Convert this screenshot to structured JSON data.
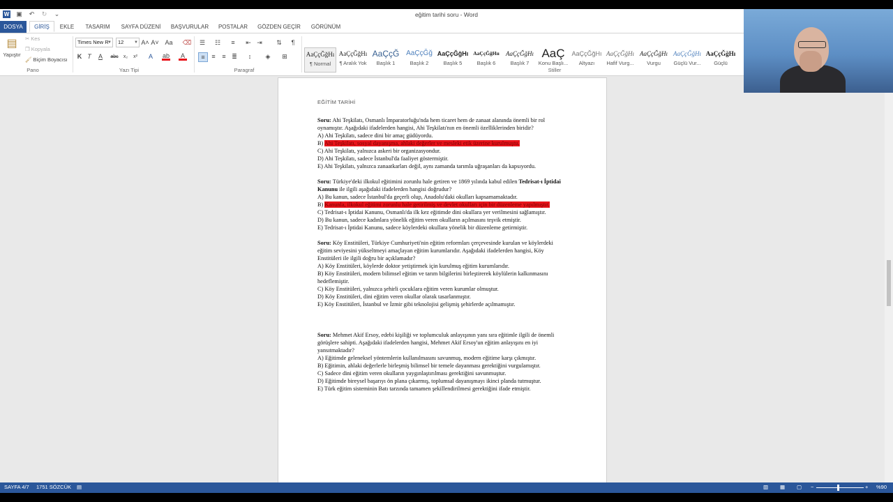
{
  "window": {
    "title": "eğitim tarihi soru - Word"
  },
  "quick_access": {
    "icons": [
      "word-icon",
      "save-icon",
      "undo-icon",
      "redo-icon",
      "customize-icon"
    ]
  },
  "tabs": [
    {
      "label": "DOSYA"
    },
    {
      "label": "GİRİŞ"
    },
    {
      "label": "EKLE"
    },
    {
      "label": "TASARIM"
    },
    {
      "label": "SAYFA DÜZENİ"
    },
    {
      "label": "BAŞVURULAR"
    },
    {
      "label": "POSTALAR"
    },
    {
      "label": "GÖZDEN GEÇİR"
    },
    {
      "label": "GÖRÜNÜM"
    }
  ],
  "ribbon": {
    "clipboard": {
      "paste": "Yapıştır",
      "cut": "Kes",
      "copy": "Kopyala",
      "format_painter": "Biçim Boyacısı",
      "label": "Pano"
    },
    "font": {
      "name": "Times New R",
      "size": "12",
      "label": "Yazı Tipi"
    },
    "paragraph": {
      "label": "Paragraf"
    },
    "styles": {
      "label": "Stiller",
      "items": [
        {
          "preview": "AaÇçĞğHı",
          "name": "¶ Normal"
        },
        {
          "preview": "AaÇçĞğHı",
          "name": "¶ Aralık Yok"
        },
        {
          "preview": "AaÇçĞ",
          "name": "Başlık 1"
        },
        {
          "preview": "AaÇçĞğ",
          "name": "Başlık 2"
        },
        {
          "preview": "AaÇçĞğHı",
          "name": "Başlık 5"
        },
        {
          "preview": "AaÇçĞğHıı",
          "name": "Başlık 6"
        },
        {
          "preview": "AaÇçĞğHı",
          "name": "Başlık 7"
        },
        {
          "preview": "AaÇ",
          "name": "Konu Başlı..."
        },
        {
          "preview": "AaÇçĞğHı",
          "name": "Altyazı"
        },
        {
          "preview": "AaÇçĞğHı",
          "name": "Hafif Vurg..."
        },
        {
          "preview": "AaÇçĞğHı",
          "name": "Vurgu"
        },
        {
          "preview": "AaÇçĞğHı",
          "name": "Güçlü Vur..."
        },
        {
          "preview": "AaÇçĞğHı",
          "name": "Güçlü"
        }
      ]
    }
  },
  "document": {
    "heading": "EĞİTİM TARİHİ",
    "questions": [
      {
        "label": "Soru:",
        "text": " Ahi Teşkilatı, Osmanlı İmparatorluğu'nda hem ticaret hem de zanaat alanında önemli bir rol oynamıştır. Aşağıdaki ifadelerden hangisi, Ahi Teşkilatı'nın en önemli özelliklerinden biridir?",
        "options": [
          {
            "prefix": "A) ",
            "text": "Ahi Teşkilatı, sadece dini bir amaç güdüyordu."
          },
          {
            "prefix": "B) ",
            "text": "Ahi Teşkilatı, sosyal dayanışma, ahlaki değerler ve mesleki etik üzerine kurulmuştu."
          },
          {
            "prefix": "C) ",
            "text": "Ahi Teşkilatı, yalnızca askeri bir organizasyondur."
          },
          {
            "prefix": "D) ",
            "text": "Ahi Teşkilatı, sadece İstanbul'da faaliyet göstermiştir."
          },
          {
            "prefix": "E) ",
            "text": "Ahi Teşkilatı, yalnızca zanaatkarları değil, aynı zamanda tarımla uğraşanları da kapsıyordu."
          }
        ]
      },
      {
        "label": "Soru:",
        "text_a": " Türkiye'deki ilkokul eğitimini zorunlu hale getiren ve 1869 yılında kabul edilen ",
        "bold": "Tedrisat-ı İptidai Kanunu",
        "text_b": " ile ilgili aşağıdaki ifadelerden hangisi doğrudur?",
        "options": [
          {
            "prefix": "A) ",
            "text": "Bu kanun, sadece İstanbul'da geçerli olup, Anadolu'daki okulları kapsamamaktadır."
          },
          {
            "prefix": "B) ",
            "text": "Kanunla, ilkokul eğitimi zorunlu hale getirilmiş ve devlet okulları için bir düzenleme yapılmıştır."
          },
          {
            "prefix": "C) ",
            "text": "Tedrisat-ı İptidai Kanunu, Osmanlı'da ilk kez eğitimde dini okullara yer verilmesini sağlamıştır."
          },
          {
            "prefix": "D) ",
            "text": "Bu kanun, sadece kadınlara yönelik eğitim veren okulların açılmasını teşvik etmiştir."
          },
          {
            "prefix": "E) ",
            "text": "Tedrisat-ı İptidai Kanunu, sadece köylerdeki okullara yönelik bir düzenleme getirmiştir."
          }
        ]
      },
      {
        "label": "Soru:",
        "text": " Köy Enstitüleri, Türkiye Cumhuriyeti'nin eğitim reformları çerçevesinde kurulan ve köylerdeki eğitim seviyesini yükseltmeyi amaçlayan eğitim kurumlarıdır. Aşağıdaki ifadelerden hangisi, Köy Enstitüleri ile ilgili doğru bir açıklamadır?",
        "options": [
          {
            "prefix": "A) ",
            "text": "Köy Enstitüleri,  köylerde doktor yetiştirmek için kurulmuş eğitim kurumlarıdır."
          },
          {
            "prefix": "B) ",
            "text": "Köy Enstitüleri, modern bilimsel eğitim ve tarım bilgilerini birleştirerek köylülerin kalkınmasını hedeflemiştir."
          },
          {
            "prefix": "C) ",
            "text": "Köy Enstitüleri, yalnızca şehirli çocuklara eğitim veren kurumlar olmuştur."
          },
          {
            "prefix": "D) ",
            "text": "Köy Enstitüleri, dini eğitim veren okullar olarak tasarlanmıştır."
          },
          {
            "prefix": "E) ",
            "text": "Köy Enstitüleri,  İstanbul ve İzmir gibi teknolojisi gelişmiş şehirlerde açılmamıştır."
          }
        ]
      },
      {
        "label": "Soru:",
        "text": " Mehmet Akif Ersoy, edebi kişiliği ve toplumculuk anlayışının yanı sıra eğitimle ilgili de önemli görüşlere sahipti. Aşağıdaki ifadelerden hangisi, Mehmet Akif Ersoy'un eğitim anlayışını en iyi yansıtmaktadır?",
        "options": [
          {
            "prefix": "A) ",
            "text": "Eğitimde  geleneksel yöntemlerin kullanılmasını savunmuş, modern eğitime karşı çıkmıştır."
          },
          {
            "prefix": "B) ",
            "text": "Eğitimin, ahlaki değerlerle birleşmiş bilimsel bir temele dayanması gerektiğini vurgulamıştır."
          },
          {
            "prefix": "C) ",
            "text": "Sadece dini eğitim veren okulların yaygınlaştırılması gerektiğini savunmuştur."
          },
          {
            "prefix": "D) ",
            "text": "Eğitimde bireysel başarıyı ön plana çıkarmış, toplumsal dayanışmayı ikinci planda tutmuştur."
          },
          {
            "prefix": "E) ",
            "text": "Türk eğitim sisteminin Batı tarzında tamamen şekillendirilmesi gerektiğini ifade etmiştir."
          }
        ]
      }
    ]
  },
  "statusbar": {
    "page": "SAYFA 4/7",
    "words": "1751 SÖZCÜK",
    "zoom": "%90"
  },
  "colors": {
    "accent": "#2b579a",
    "highlight": "#e8141b"
  }
}
